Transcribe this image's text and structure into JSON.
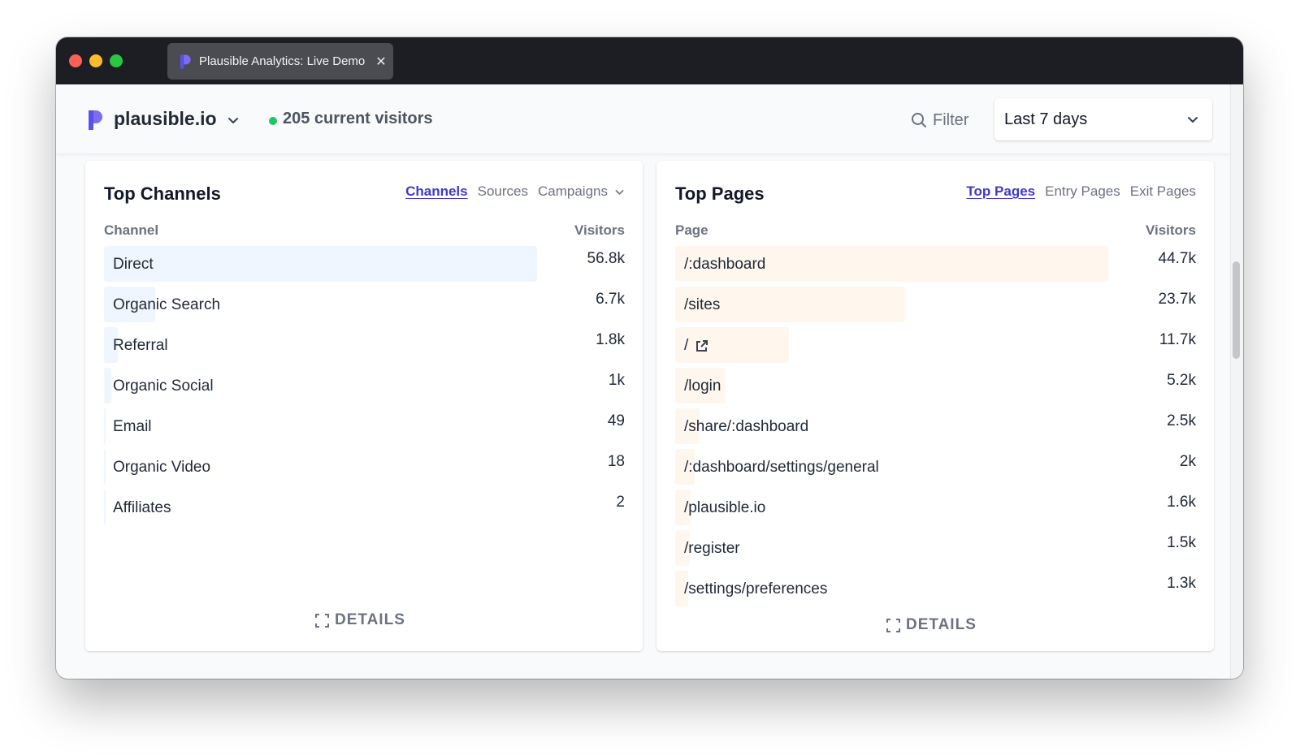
{
  "browser": {
    "tab_title": "Plausible Analytics: Live Demo",
    "close_glyph": "✕"
  },
  "header": {
    "site_name": "plausible.io",
    "current_visitors": "205 current visitors",
    "filter_label": "Filter",
    "period_label": "Last 7 days"
  },
  "colors": {
    "brand": "#5850ec",
    "live": "#22c55e",
    "active_tab": "#4338ca",
    "bar_channels": "#eff6ff",
    "bar_pages": "#fff7ed"
  },
  "top_channels": {
    "title": "Top Channels",
    "tabs": [
      "Channels",
      "Sources",
      "Campaigns"
    ],
    "active_tab": "Channels",
    "col_label": "Channel",
    "col_value": "Visitors",
    "rows": [
      {
        "label": "Direct",
        "value": "56.8k",
        "visitors": 56800
      },
      {
        "label": "Organic Search",
        "value": "6.7k",
        "visitors": 6700
      },
      {
        "label": "Referral",
        "value": "1.8k",
        "visitors": 1800
      },
      {
        "label": "Organic Social",
        "value": "1k",
        "visitors": 1000
      },
      {
        "label": "Email",
        "value": "49",
        "visitors": 49
      },
      {
        "label": "Organic Video",
        "value": "18",
        "visitors": 18
      },
      {
        "label": "Affiliates",
        "value": "2",
        "visitors": 2
      }
    ],
    "details_label": "DETAILS"
  },
  "top_pages": {
    "title": "Top Pages",
    "tabs": [
      "Top Pages",
      "Entry Pages",
      "Exit Pages"
    ],
    "active_tab": "Top Pages",
    "col_label": "Page",
    "col_value": "Visitors",
    "rows": [
      {
        "label": "/:dashboard",
        "value": "44.7k",
        "visitors": 44700
      },
      {
        "label": "/sites",
        "value": "23.7k",
        "visitors": 23700
      },
      {
        "label": "/",
        "value": "11.7k",
        "visitors": 11700,
        "external_link": true
      },
      {
        "label": "/login",
        "value": "5.2k",
        "visitors": 5200
      },
      {
        "label": "/share/:dashboard",
        "value": "2.5k",
        "visitors": 2500
      },
      {
        "label": "/:dashboard/settings/general",
        "value": "2k",
        "visitors": 2000
      },
      {
        "label": "/plausible.io",
        "value": "1.6k",
        "visitors": 1600
      },
      {
        "label": "/register",
        "value": "1.5k",
        "visitors": 1500
      },
      {
        "label": "/settings/preferences",
        "value": "1.3k",
        "visitors": 1300
      }
    ],
    "details_label": "DETAILS"
  }
}
